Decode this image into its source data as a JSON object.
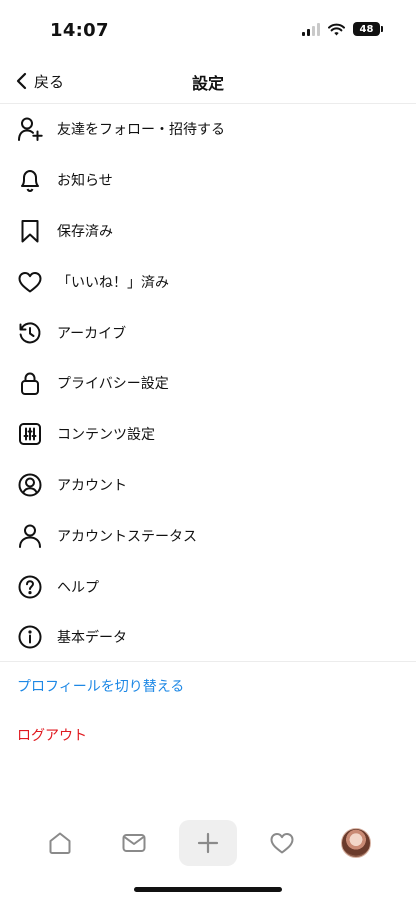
{
  "status_bar": {
    "time": "14:07",
    "battery": "48"
  },
  "header": {
    "back_label": "戻る",
    "title": "設定"
  },
  "menu": [
    {
      "label": "友達をフォロー・招待する",
      "icon": "add-person-icon"
    },
    {
      "label": "お知らせ",
      "icon": "bell-icon"
    },
    {
      "label": "保存済み",
      "icon": "bookmark-icon"
    },
    {
      "label": "「いいね！」済み",
      "icon": "heart-icon"
    },
    {
      "label": "アーカイブ",
      "icon": "history-icon"
    },
    {
      "label": "プライバシー設定",
      "icon": "lock-icon"
    },
    {
      "label": "コンテンツ設定",
      "icon": "sliders-icon"
    },
    {
      "label": "アカウント",
      "icon": "account-circle-icon"
    },
    {
      "label": "アカウントステータス",
      "icon": "person-icon"
    },
    {
      "label": "ヘルプ",
      "icon": "help-icon"
    },
    {
      "label": "基本データ",
      "icon": "info-icon"
    }
  ],
  "links": {
    "switch_profile": "プロフィールを切り替える",
    "logout": "ログアウト"
  },
  "colors": {
    "link_blue": "#1e88e5",
    "logout_red": "#e0191f",
    "divider": "#ececec",
    "create_tab_bg": "#efefef"
  },
  "tab_bar": [
    "home-icon",
    "mail-icon",
    "plus-icon",
    "heart-icon",
    "avatar"
  ]
}
